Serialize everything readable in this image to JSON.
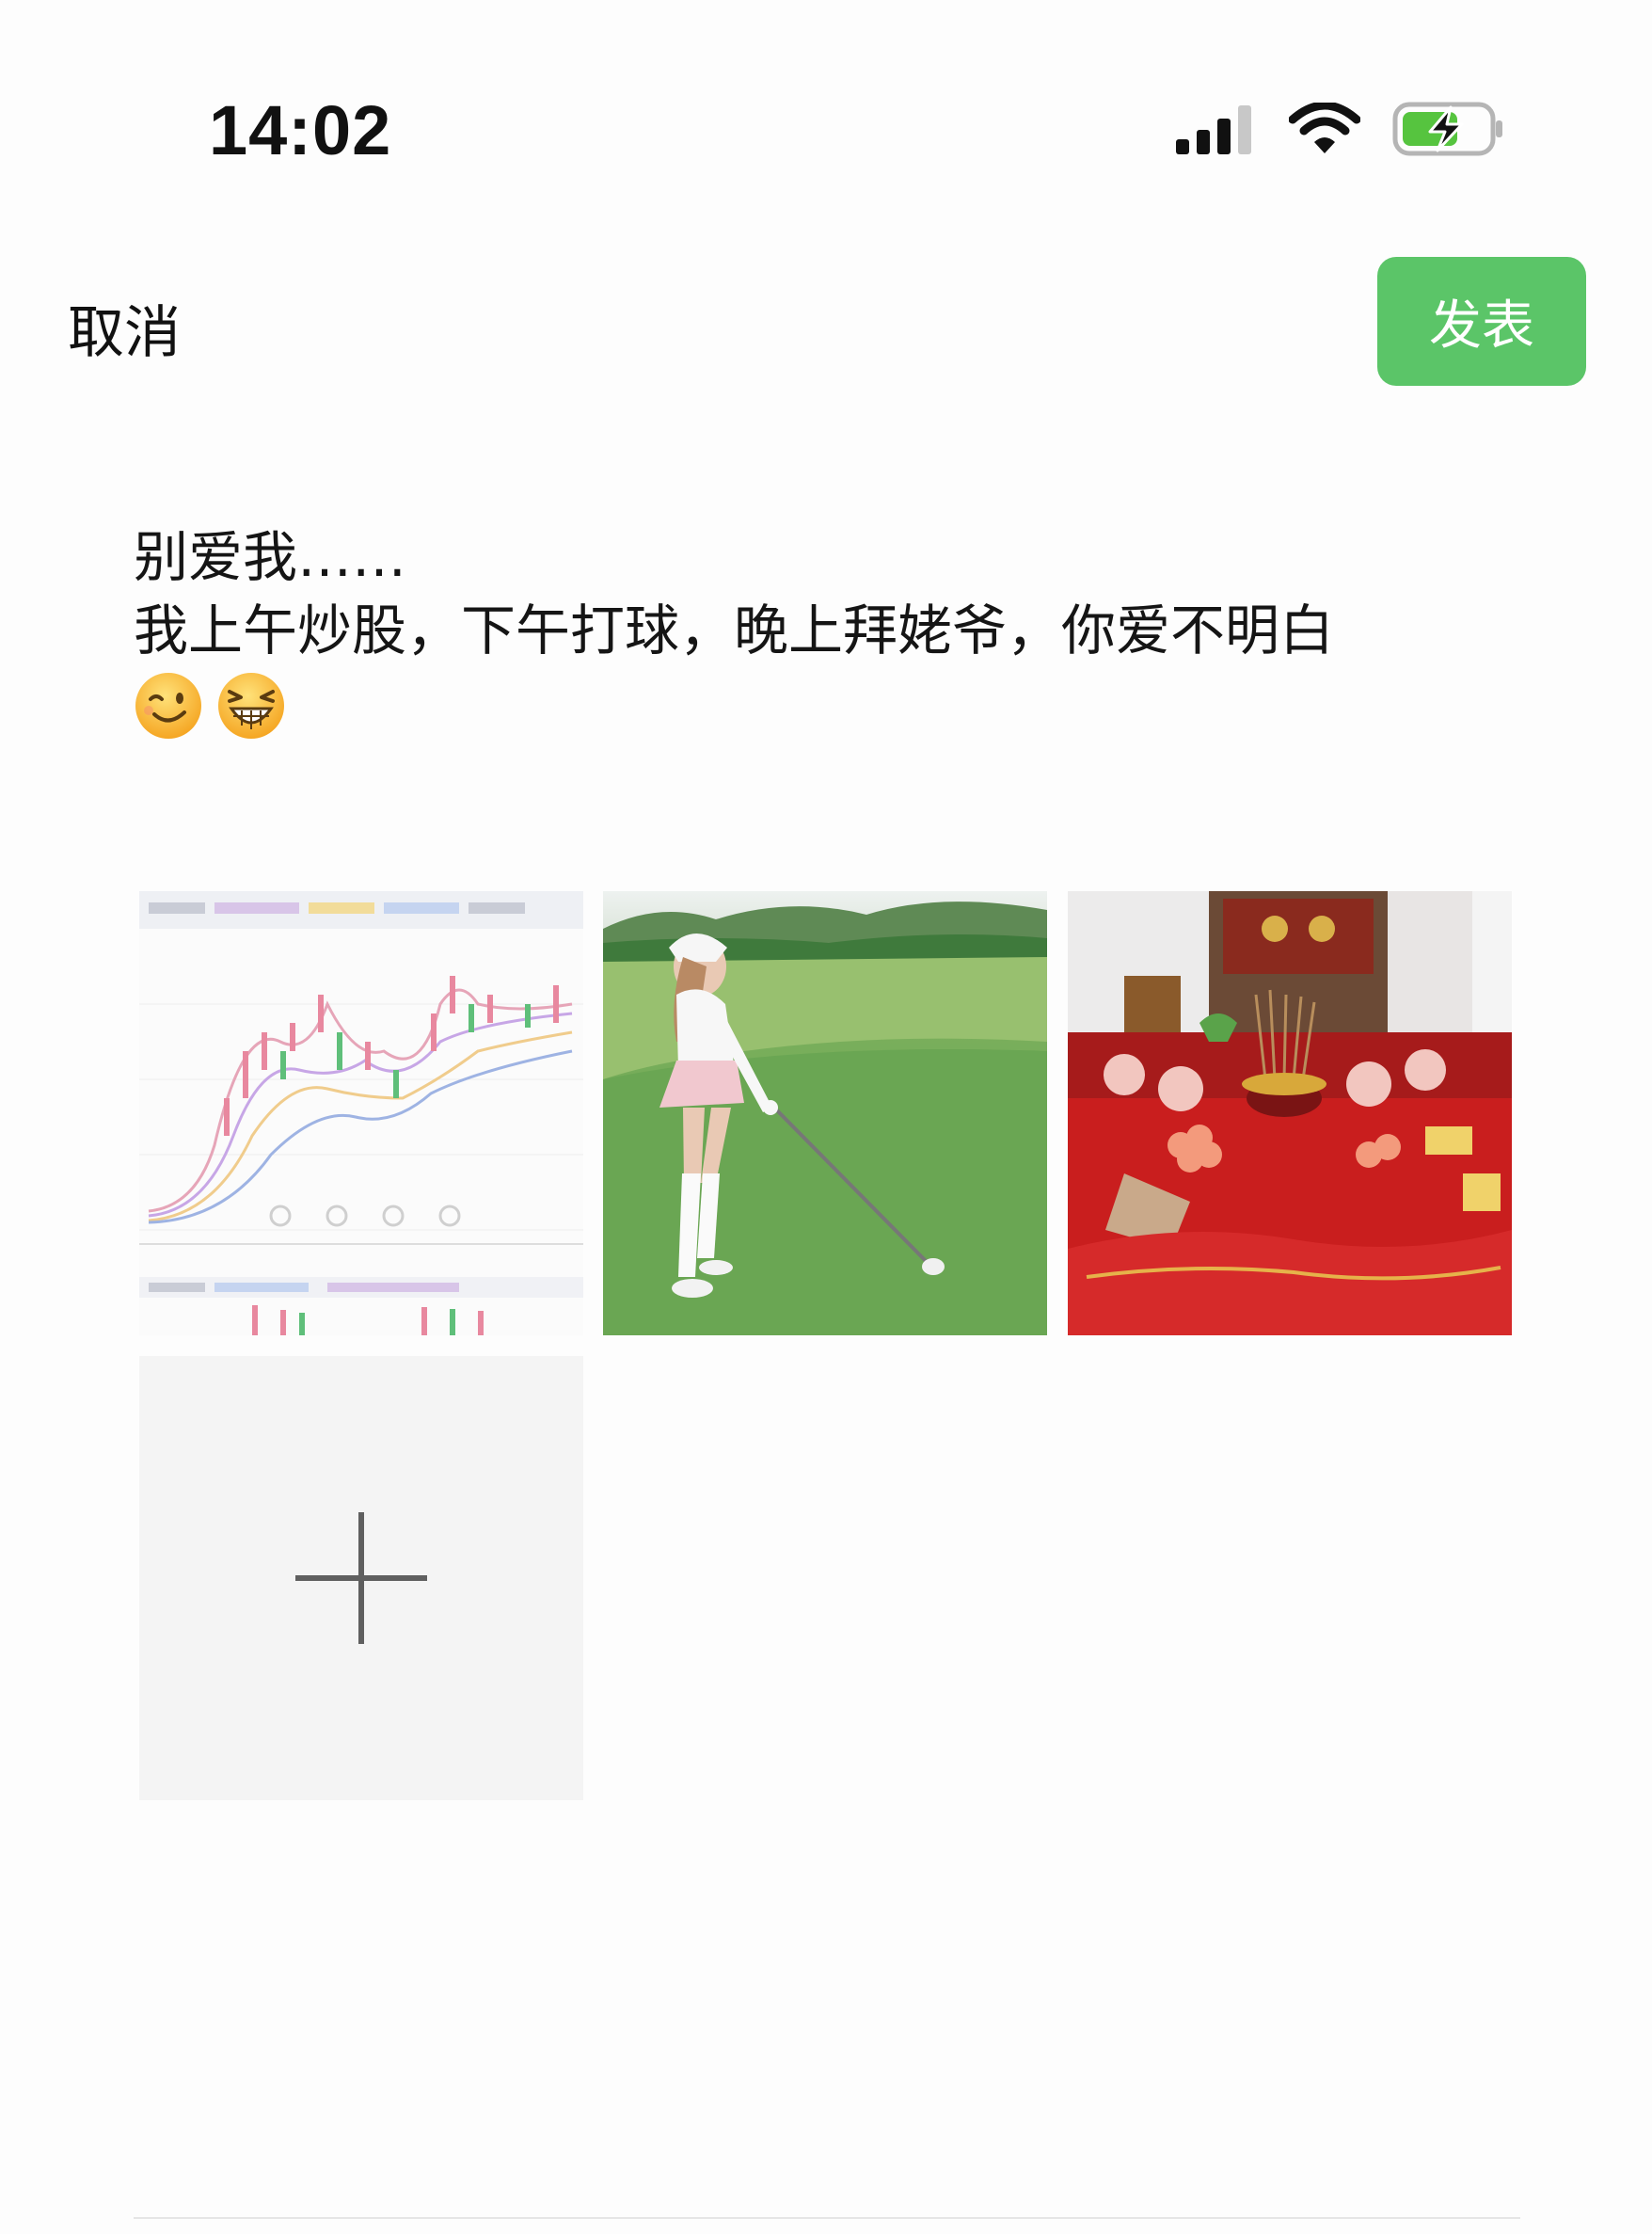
{
  "status_bar": {
    "time": "14:02",
    "icons": [
      "cellular-signal-icon",
      "wifi-icon",
      "battery-charging-icon"
    ]
  },
  "header": {
    "cancel_label": "取消",
    "publish_label": "发表",
    "publish_color": "#5bc568"
  },
  "post": {
    "line1": "别爱我……",
    "line2": "我上午炒股，下午打球，晚上拜姥爷，你爱不明白",
    "emojis": [
      "winking-face-emoji",
      "grinning-squinting-face-emoji"
    ]
  },
  "images": [
    {
      "name": "stock-chart-photo"
    },
    {
      "name": "golf-player-photo"
    },
    {
      "name": "altar-offerings-photo"
    }
  ],
  "add_tile": {
    "icon": "plus-icon"
  }
}
